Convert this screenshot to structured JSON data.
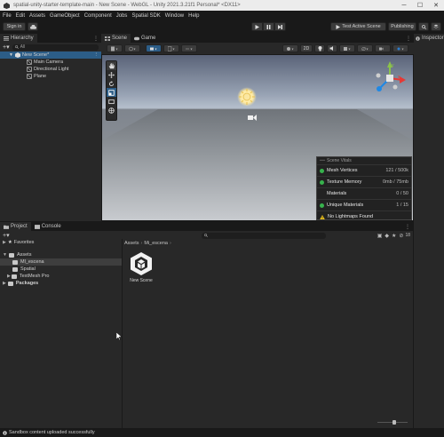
{
  "window": {
    "title": "spatial-unity-starter-template-main - New Scene - WebGL - Unity 2021.3.21f1 Personal* <DX11>"
  },
  "menu": [
    "File",
    "Edit",
    "Assets",
    "GameObject",
    "Component",
    "Jobs",
    "Spatial SDK",
    "Window",
    "Help"
  ],
  "toolbar": {
    "sign_in": "Sign in",
    "test_active_scene": "Test Active Scene",
    "publishing": "Publishing"
  },
  "hierarchy": {
    "tab": "Hierarchy",
    "search_value": "All",
    "items": [
      "New Scene*",
      "Main Camera",
      "Directional Light",
      "Plane"
    ]
  },
  "scene": {
    "tabs": [
      "Scene",
      "Game"
    ],
    "toggle_2d": "2D",
    "gizmo_label": "< Persp"
  },
  "inspector": {
    "tab": "Inspector"
  },
  "vitals": {
    "header": "Scene Vitals",
    "rows": [
      {
        "label": "Mesh Vertices",
        "value": "121 / 500k",
        "status": "ok"
      },
      {
        "label": "Texture Memory",
        "value": "0mb / 75mb",
        "status": "ok"
      },
      {
        "label": "Materials",
        "value": "0 / 50",
        "status": "none"
      },
      {
        "label": "Unique Materials",
        "value": "1 / 15",
        "status": "ok"
      },
      {
        "label": "No Lightmaps Found",
        "value": "",
        "status": "warn"
      }
    ]
  },
  "project": {
    "tabs": [
      "Project",
      "Console"
    ],
    "favorites": "Favorites",
    "assets": "Assets",
    "folders": [
      "Ml_escena",
      "Spatial",
      "TextMesh Pro"
    ],
    "packages": "Packages",
    "breadcrumb": [
      "Assets",
      "Mi_escena"
    ],
    "files": [
      {
        "name": "New Scene"
      }
    ],
    "hidden_count": "18"
  },
  "status": {
    "message": "Sandbox content uploaded successfully"
  },
  "colors": {
    "accent_blue": "#2c5d87",
    "ok_green": "#37b24d",
    "warn_yellow": "#f0c419"
  }
}
